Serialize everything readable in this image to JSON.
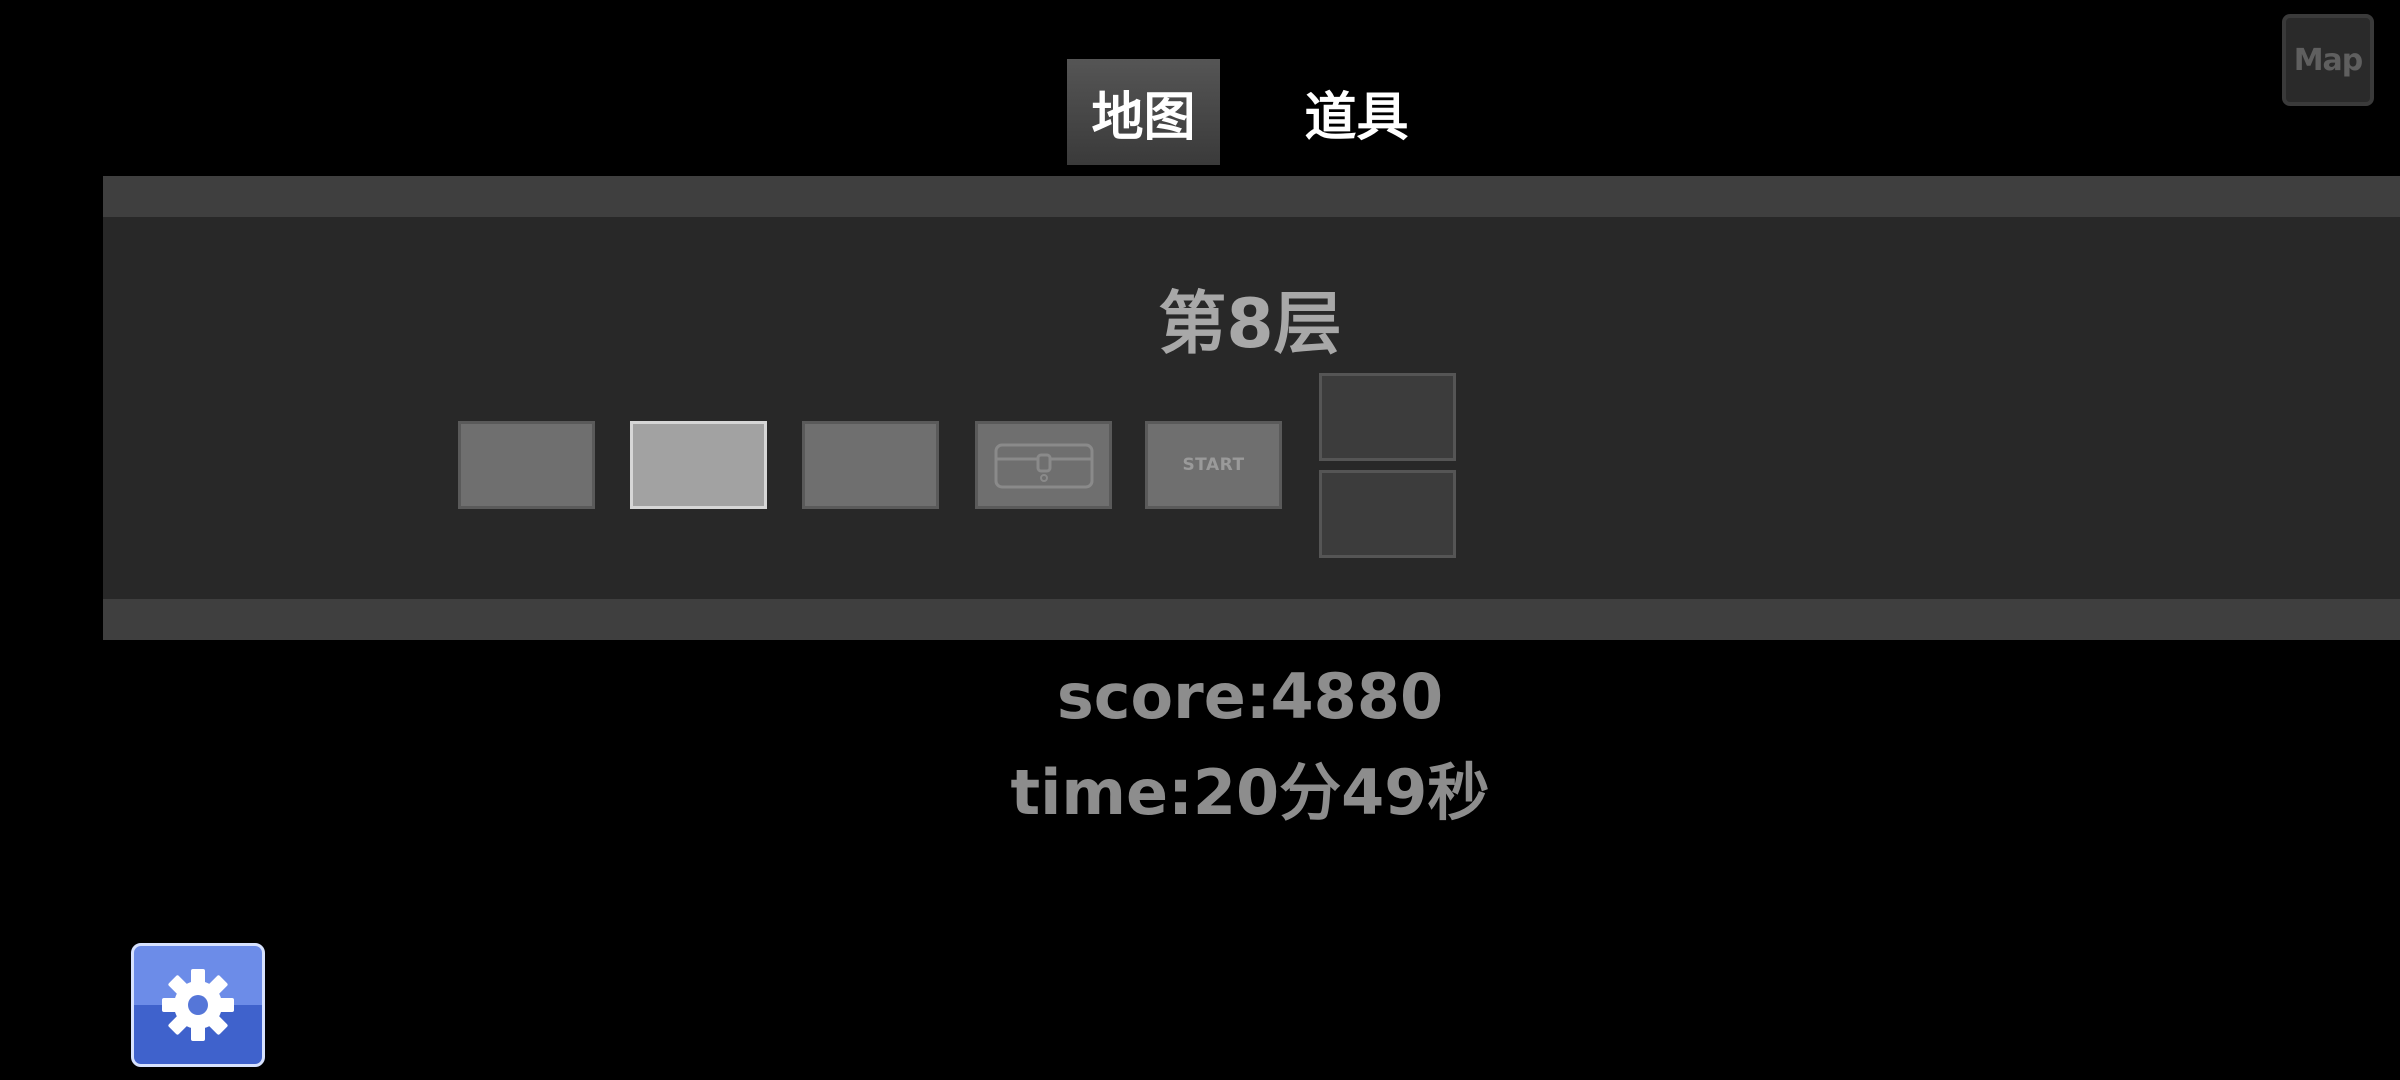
{
  "tabs": {
    "map_label": "地图",
    "items_label": "道具"
  },
  "map_button": {
    "label": "Map",
    "icon": "map-icon"
  },
  "floor": {
    "title": "第8层"
  },
  "rooms": [
    {
      "state": "visited",
      "label": ""
    },
    {
      "state": "current",
      "label": ""
    },
    {
      "state": "visited",
      "label": ""
    },
    {
      "state": "visited",
      "icon": "treasure-chest-icon",
      "label": ""
    },
    {
      "state": "visited",
      "label": "START"
    },
    {
      "state": "unexplored",
      "label": ""
    },
    {
      "state": "unexplored",
      "label": ""
    }
  ],
  "stats": {
    "score": "score:4880",
    "time": "time:20分49秒"
  },
  "settings": {
    "icon": "gear-icon"
  },
  "colors": {
    "background": "#000000",
    "panel": "#282828",
    "panel_bar": "#3f3f3f",
    "room_visited": "#6f6f6f",
    "room_current": "#a2a2a2",
    "room_unexplored": "#3c3c3c",
    "settings_blue": "#4f72d8"
  }
}
